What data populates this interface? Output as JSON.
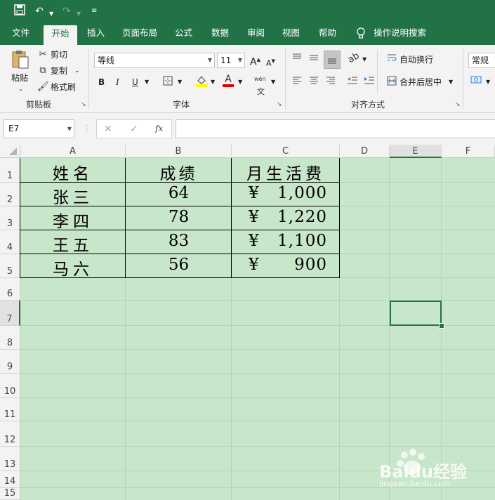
{
  "quick_access": {
    "save_icon": "save-icon",
    "undo_icon": "undo-icon",
    "redo_icon": "redo-icon",
    "customize_icon": "customize-qat-icon"
  },
  "tabs": [
    "文件",
    "开始",
    "插入",
    "页面布局",
    "公式",
    "数据",
    "审阅",
    "视图",
    "帮助"
  ],
  "active_tab": "开始",
  "tell_me": "操作说明搜索",
  "ribbon": {
    "clipboard": {
      "paste": "粘贴",
      "cut": "剪切",
      "copy": "复制",
      "format_painter": "格式刷",
      "group": "剪贴板"
    },
    "font": {
      "name": "等线",
      "size": "11",
      "group": "字体",
      "bold": "B",
      "italic": "I",
      "underline": "U",
      "grow": "A",
      "shrink": "A",
      "font_color": "A",
      "phonetic": "wén"
    },
    "alignment": {
      "wrap_text": "自动换行",
      "merge_center": "合并后居中",
      "group": "对齐方式"
    },
    "number": {
      "format": "常规"
    }
  },
  "formula_bar": {
    "name_box": "E7",
    "cancel": "✕",
    "enter": "✓",
    "fx": "fx",
    "content": ""
  },
  "columns": [
    "A",
    "B",
    "C",
    "D",
    "E",
    "F"
  ],
  "selected_column": "E",
  "rows": [
    "1",
    "2",
    "3",
    "4",
    "5",
    "6",
    "7",
    "8",
    "9",
    "10",
    "11",
    "12",
    "13",
    "14",
    "15"
  ],
  "selected_row": "7",
  "table": {
    "headers": [
      "姓名",
      "成绩",
      "月生活费"
    ],
    "rows": [
      {
        "name": "张三",
        "score": "64",
        "currency": "¥",
        "amount": "1,000"
      },
      {
        "name": "李四",
        "score": "78",
        "currency": "¥",
        "amount": "1,220"
      },
      {
        "name": "王五",
        "score": "83",
        "currency": "¥",
        "amount": "1,100"
      },
      {
        "name": "马六",
        "score": "56",
        "currency": "¥",
        "amount": "900"
      }
    ]
  },
  "colors": {
    "brand": "#217346",
    "sheet_bg": "#c8e6c9",
    "gridline": "#b5d3b8"
  },
  "watermark": {
    "brand": "Baidu经验",
    "url": "jingyan.baidu.com"
  }
}
